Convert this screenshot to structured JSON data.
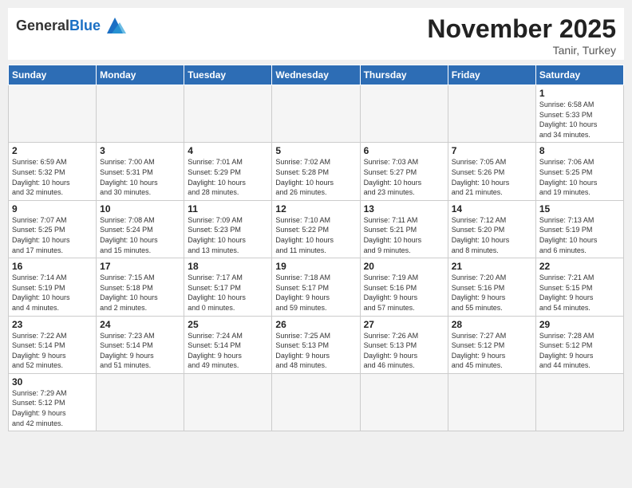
{
  "header": {
    "logo_general": "General",
    "logo_blue": "Blue",
    "title": "November 2025",
    "location": "Tanir, Turkey"
  },
  "weekdays": [
    "Sunday",
    "Monday",
    "Tuesday",
    "Wednesday",
    "Thursday",
    "Friday",
    "Saturday"
  ],
  "weeks": [
    [
      {
        "day": "",
        "info": ""
      },
      {
        "day": "",
        "info": ""
      },
      {
        "day": "",
        "info": ""
      },
      {
        "day": "",
        "info": ""
      },
      {
        "day": "",
        "info": ""
      },
      {
        "day": "",
        "info": ""
      },
      {
        "day": "1",
        "info": "Sunrise: 6:58 AM\nSunset: 5:33 PM\nDaylight: 10 hours\nand 34 minutes."
      }
    ],
    [
      {
        "day": "2",
        "info": "Sunrise: 6:59 AM\nSunset: 5:32 PM\nDaylight: 10 hours\nand 32 minutes."
      },
      {
        "day": "3",
        "info": "Sunrise: 7:00 AM\nSunset: 5:31 PM\nDaylight: 10 hours\nand 30 minutes."
      },
      {
        "day": "4",
        "info": "Sunrise: 7:01 AM\nSunset: 5:29 PM\nDaylight: 10 hours\nand 28 minutes."
      },
      {
        "day": "5",
        "info": "Sunrise: 7:02 AM\nSunset: 5:28 PM\nDaylight: 10 hours\nand 26 minutes."
      },
      {
        "day": "6",
        "info": "Sunrise: 7:03 AM\nSunset: 5:27 PM\nDaylight: 10 hours\nand 23 minutes."
      },
      {
        "day": "7",
        "info": "Sunrise: 7:05 AM\nSunset: 5:26 PM\nDaylight: 10 hours\nand 21 minutes."
      },
      {
        "day": "8",
        "info": "Sunrise: 7:06 AM\nSunset: 5:25 PM\nDaylight: 10 hours\nand 19 minutes."
      }
    ],
    [
      {
        "day": "9",
        "info": "Sunrise: 7:07 AM\nSunset: 5:25 PM\nDaylight: 10 hours\nand 17 minutes."
      },
      {
        "day": "10",
        "info": "Sunrise: 7:08 AM\nSunset: 5:24 PM\nDaylight: 10 hours\nand 15 minutes."
      },
      {
        "day": "11",
        "info": "Sunrise: 7:09 AM\nSunset: 5:23 PM\nDaylight: 10 hours\nand 13 minutes."
      },
      {
        "day": "12",
        "info": "Sunrise: 7:10 AM\nSunset: 5:22 PM\nDaylight: 10 hours\nand 11 minutes."
      },
      {
        "day": "13",
        "info": "Sunrise: 7:11 AM\nSunset: 5:21 PM\nDaylight: 10 hours\nand 9 minutes."
      },
      {
        "day": "14",
        "info": "Sunrise: 7:12 AM\nSunset: 5:20 PM\nDaylight: 10 hours\nand 8 minutes."
      },
      {
        "day": "15",
        "info": "Sunrise: 7:13 AM\nSunset: 5:19 PM\nDaylight: 10 hours\nand 6 minutes."
      }
    ],
    [
      {
        "day": "16",
        "info": "Sunrise: 7:14 AM\nSunset: 5:19 PM\nDaylight: 10 hours\nand 4 minutes."
      },
      {
        "day": "17",
        "info": "Sunrise: 7:15 AM\nSunset: 5:18 PM\nDaylight: 10 hours\nand 2 minutes."
      },
      {
        "day": "18",
        "info": "Sunrise: 7:17 AM\nSunset: 5:17 PM\nDaylight: 10 hours\nand 0 minutes."
      },
      {
        "day": "19",
        "info": "Sunrise: 7:18 AM\nSunset: 5:17 PM\nDaylight: 9 hours\nand 59 minutes."
      },
      {
        "day": "20",
        "info": "Sunrise: 7:19 AM\nSunset: 5:16 PM\nDaylight: 9 hours\nand 57 minutes."
      },
      {
        "day": "21",
        "info": "Sunrise: 7:20 AM\nSunset: 5:16 PM\nDaylight: 9 hours\nand 55 minutes."
      },
      {
        "day": "22",
        "info": "Sunrise: 7:21 AM\nSunset: 5:15 PM\nDaylight: 9 hours\nand 54 minutes."
      }
    ],
    [
      {
        "day": "23",
        "info": "Sunrise: 7:22 AM\nSunset: 5:14 PM\nDaylight: 9 hours\nand 52 minutes."
      },
      {
        "day": "24",
        "info": "Sunrise: 7:23 AM\nSunset: 5:14 PM\nDaylight: 9 hours\nand 51 minutes."
      },
      {
        "day": "25",
        "info": "Sunrise: 7:24 AM\nSunset: 5:14 PM\nDaylight: 9 hours\nand 49 minutes."
      },
      {
        "day": "26",
        "info": "Sunrise: 7:25 AM\nSunset: 5:13 PM\nDaylight: 9 hours\nand 48 minutes."
      },
      {
        "day": "27",
        "info": "Sunrise: 7:26 AM\nSunset: 5:13 PM\nDaylight: 9 hours\nand 46 minutes."
      },
      {
        "day": "28",
        "info": "Sunrise: 7:27 AM\nSunset: 5:12 PM\nDaylight: 9 hours\nand 45 minutes."
      },
      {
        "day": "29",
        "info": "Sunrise: 7:28 AM\nSunset: 5:12 PM\nDaylight: 9 hours\nand 44 minutes."
      }
    ],
    [
      {
        "day": "30",
        "info": "Sunrise: 7:29 AM\nSunset: 5:12 PM\nDaylight: 9 hours\nand 42 minutes."
      },
      {
        "day": "",
        "info": ""
      },
      {
        "day": "",
        "info": ""
      },
      {
        "day": "",
        "info": ""
      },
      {
        "day": "",
        "info": ""
      },
      {
        "day": "",
        "info": ""
      },
      {
        "day": "",
        "info": ""
      }
    ]
  ]
}
